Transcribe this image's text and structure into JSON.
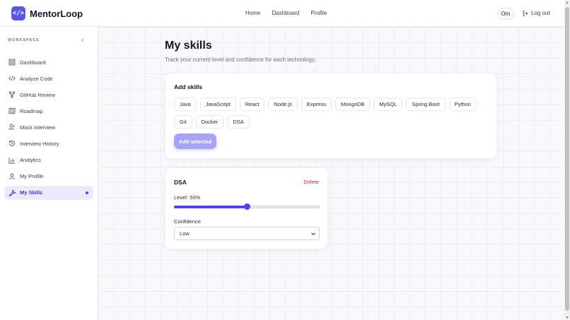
{
  "app": {
    "name": "MentorLoop",
    "logo_glyph": "</>"
  },
  "topnav": {
    "items": [
      "Home",
      "Dashboard",
      "Profile"
    ],
    "user": "Om",
    "logout": "Log out"
  },
  "sidebar": {
    "section_label": "WORKSPACE",
    "items": [
      {
        "label": "Dashboard",
        "icon": "grid-icon"
      },
      {
        "label": "Analyze Code",
        "icon": "code-icon"
      },
      {
        "label": "GitHub Review",
        "icon": "git-branch-icon"
      },
      {
        "label": "Roadmap",
        "icon": "map-icon"
      },
      {
        "label": "Mock Interview",
        "icon": "user-mic-icon"
      },
      {
        "label": "Interview History",
        "icon": "history-icon"
      },
      {
        "label": "Analytics",
        "icon": "bar-chart-icon"
      },
      {
        "label": "My Profile",
        "icon": "user-icon"
      },
      {
        "label": "My Skills",
        "icon": "wrench-icon",
        "active": true
      }
    ]
  },
  "main": {
    "title": "My skills",
    "subtitle": "Track your current level and confidence for each technology.",
    "add_card": {
      "title": "Add skills",
      "chips": [
        "Java",
        "JavaScript",
        "React",
        "Node.js",
        "Express",
        "MongoDB",
        "MySQL",
        "Spring Boot",
        "Python",
        "Git",
        "Docker",
        "DSA"
      ],
      "button": "Add selected"
    },
    "skill_card": {
      "name": "DSA",
      "delete_label": "Delete",
      "level_label": "Level: 50%",
      "level_value": 0.5,
      "confidence_label": "Confidence",
      "confidence_value": "Low"
    }
  },
  "colors": {
    "accent": "#4f46e5",
    "accent_light": "#a7a3f5",
    "danger": "#dc2626"
  }
}
